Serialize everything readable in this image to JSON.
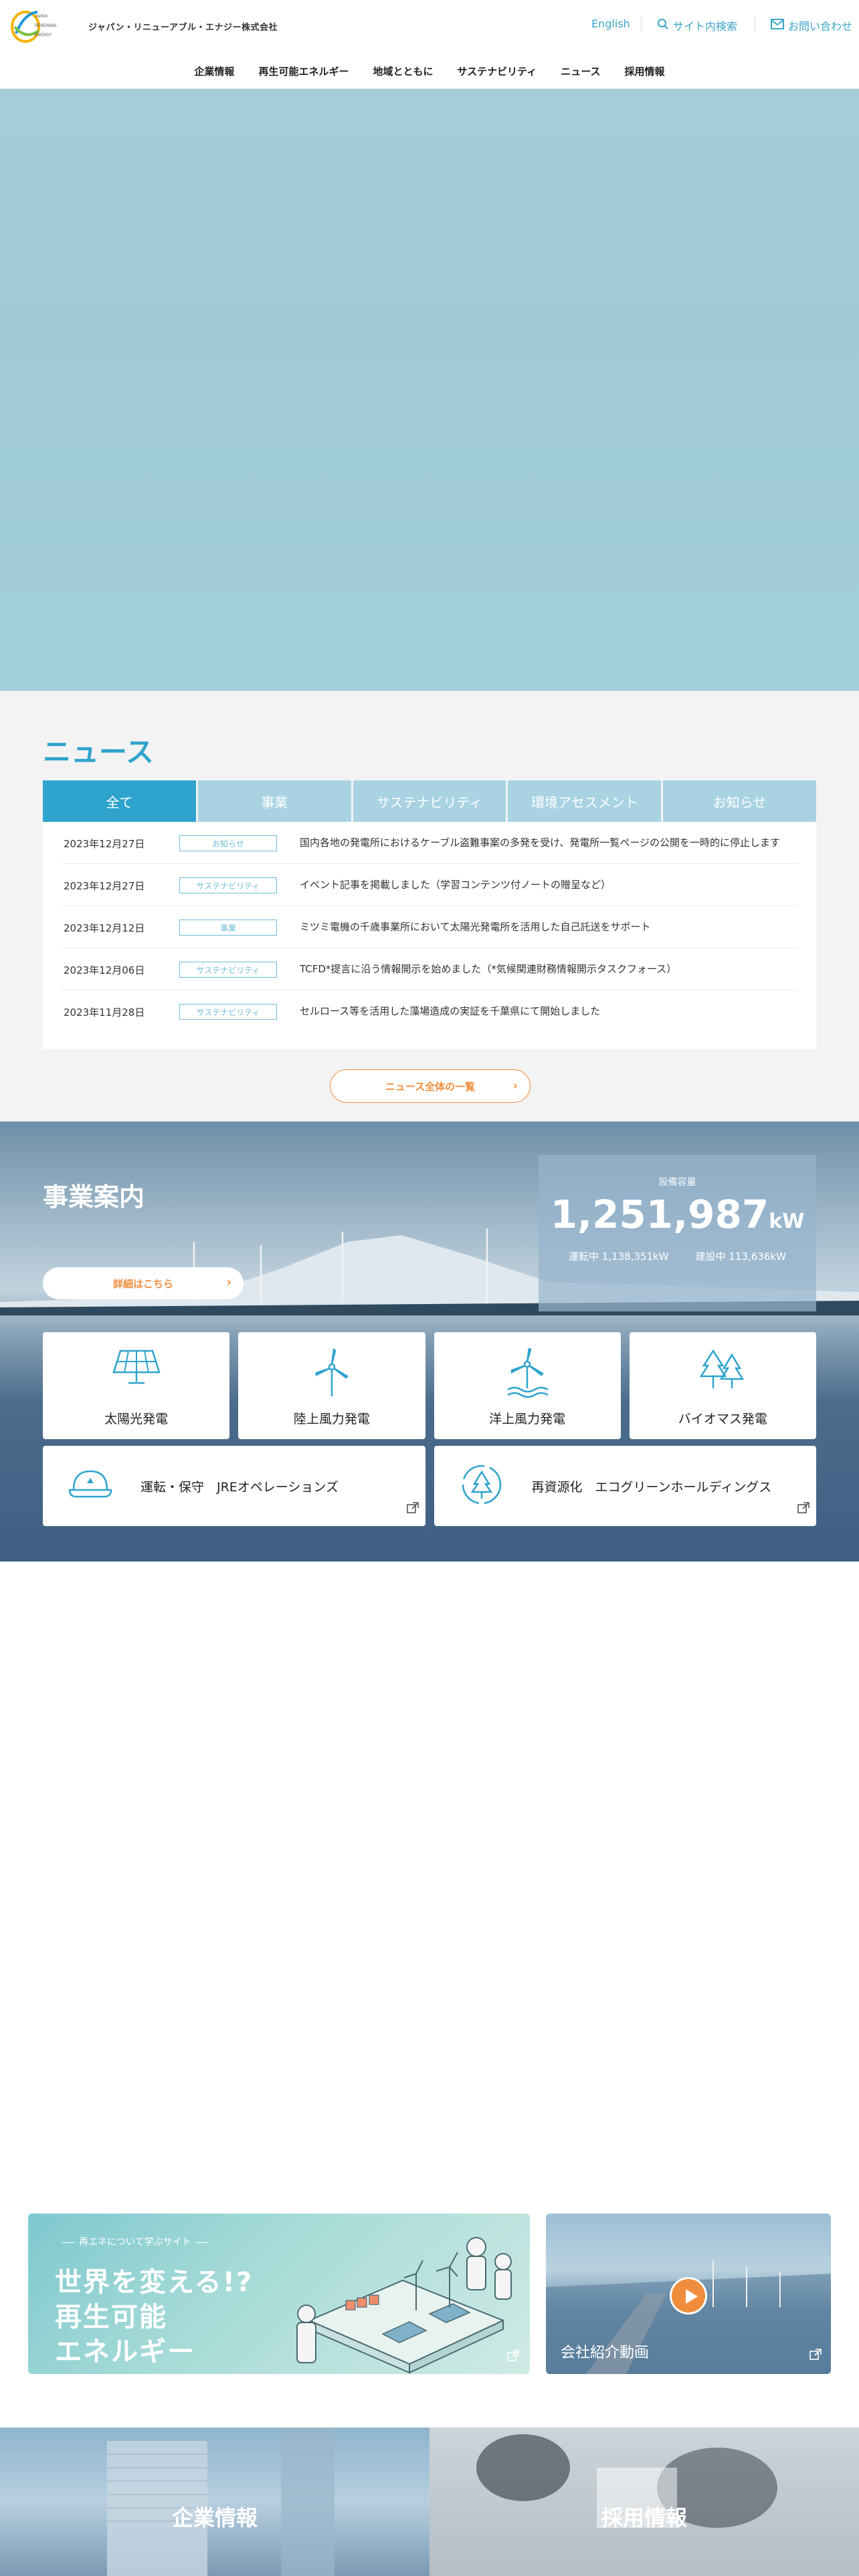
{
  "header": {
    "company_name": "ジャパン・リニューアブル・エナジー株式会社",
    "logo_text": "JAPAN RENEWABLE ENERGY",
    "english": "English",
    "site_search": "サイト内検索",
    "contact": "お問い合わせ",
    "nav": [
      "企業情報",
      "再生可能エネルギー",
      "地域とともに",
      "サステナビリティ",
      "ニュース",
      "採用情報"
    ]
  },
  "news": {
    "title": "ニュース",
    "tabs": [
      {
        "label": "全て",
        "active": true
      },
      {
        "label": "事業",
        "active": false
      },
      {
        "label": "サステナビリティ",
        "active": false
      },
      {
        "label": "環境アセスメント",
        "active": false
      },
      {
        "label": "お知らせ",
        "active": false
      }
    ],
    "items": [
      {
        "date": "2023年12月27日",
        "category": "お知らせ",
        "text": "国内各地の発電所におけるケーブル盗難事案の多発を受け、発電所一覧ページの公開を一時的に停止します"
      },
      {
        "date": "2023年12月27日",
        "category": "サステナビリティ",
        "text": "イベント記事を掲載しました（学習コンテンツ付ノートの贈呈など）"
      },
      {
        "date": "2023年12月12日",
        "category": "事業",
        "text": "ミツミ電機の千歳事業所において太陽光発電所を活用した自己託送をサポート"
      },
      {
        "date": "2023年12月06日",
        "category": "サステナビリティ",
        "text": "TCFD*提言に沿う情報開示を始めました（*気候関連財務情報開示タスクフォース）"
      },
      {
        "date": "2023年11月28日",
        "category": "サステナビリティ",
        "text": "セルロース等を活用した藻場造成の実証を千葉県にて開始しました"
      }
    ],
    "all_label": "ニュース全体の一覧"
  },
  "business": {
    "title": "事業案内",
    "detail_label": "詳細はこちら",
    "capacity_label": "設備容量",
    "capacity_value": "1,251,987",
    "capacity_unit": "kW",
    "operating": "運転中 1,138,351kW",
    "constructing": "建設中 113,636kW",
    "cards": [
      {
        "label": "太陽光発電",
        "icon": "solar-panel-icon"
      },
      {
        "label": "陸上風力発電",
        "icon": "wind-turbine-icon"
      },
      {
        "label": "洋上風力発電",
        "icon": "offshore-wind-icon"
      },
      {
        "label": "バイオマス発電",
        "icon": "tree-icon"
      }
    ],
    "links": [
      {
        "label": "運転・保守　JREオペレーションズ",
        "icon": "helmet-icon"
      },
      {
        "label": "再資源化　エコグリーンホールディングス",
        "icon": "recycle-tree-icon"
      }
    ]
  },
  "banners": {
    "learn_tag": "再エネについて学ぶサイト",
    "learn_line1": "世界を変える!?",
    "learn_line2": "再生可能",
    "learn_line3": "エネルギー",
    "video_label": "会社紹介動画"
  },
  "tiles": {
    "corporate": "企業情報",
    "recruit": "採用情報"
  },
  "colors": {
    "accent_blue": "#2ea3cd",
    "accent_orange": "#f08d3c"
  }
}
